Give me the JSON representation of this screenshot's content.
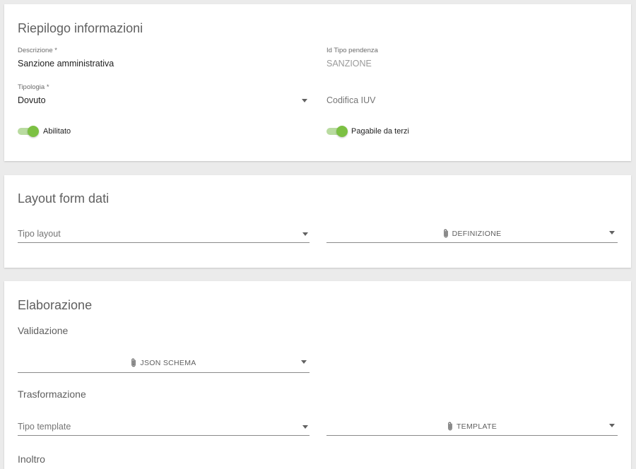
{
  "riepilogo": {
    "title": "Riepilogo informazioni",
    "descrizione": {
      "label": "Descrizione *",
      "value": "Sanzione amministrativa"
    },
    "id_tipo_pendenza": {
      "label": "Id Tipo pendenza",
      "value": "SANZIONE"
    },
    "tipologia": {
      "label": "Tipologia *",
      "value": "Dovuto"
    },
    "codifica_iuv": {
      "placeholder": "Codifica IUV"
    },
    "abilitato": {
      "label": "Abilitato",
      "on": true
    },
    "pagabile_terzi": {
      "label": "Pagabile da terzi",
      "on": true
    }
  },
  "layout_form": {
    "title": "Layout form dati",
    "tipo_layout": {
      "placeholder": "Tipo layout"
    },
    "definizione": {
      "label": "DEFINIZIONE"
    }
  },
  "elaborazione": {
    "title": "Elaborazione",
    "validazione": {
      "label": "Validazione"
    },
    "json_schema": {
      "label": "JSON SCHEMA"
    },
    "trasformazione": {
      "label": "Trasformazione"
    },
    "tipo_template": {
      "placeholder": "Tipo template"
    },
    "template": {
      "label": "TEMPLATE"
    },
    "inoltro": {
      "label": "Inoltro"
    }
  },
  "colors": {
    "toggle_thumb": "#7cc043",
    "toggle_track": "#b9dba0",
    "background": "#ebebeb"
  }
}
